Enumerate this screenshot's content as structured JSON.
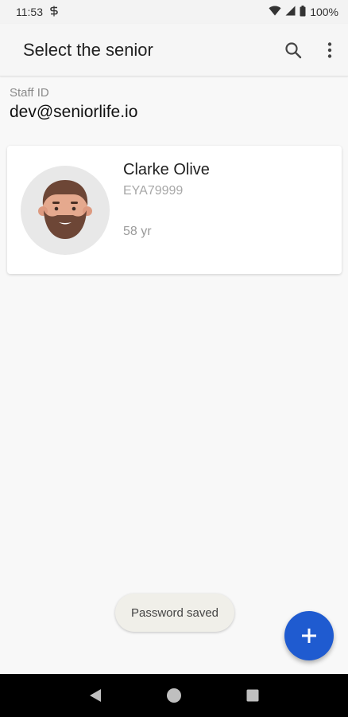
{
  "status_bar": {
    "time": "11:53",
    "battery": "100%"
  },
  "app_bar": {
    "title": "Select the senior"
  },
  "staff": {
    "label": "Staff ID",
    "value": "dev@seniorlife.io"
  },
  "seniors": [
    {
      "name": "Clarke Olive",
      "id": "EYA79999",
      "age": "58 yr"
    }
  ],
  "toast": {
    "message": "Password saved"
  },
  "colors": {
    "fab": "#1f5bd0",
    "card_bg": "#ffffff",
    "page_bg": "#f8f8f8"
  }
}
